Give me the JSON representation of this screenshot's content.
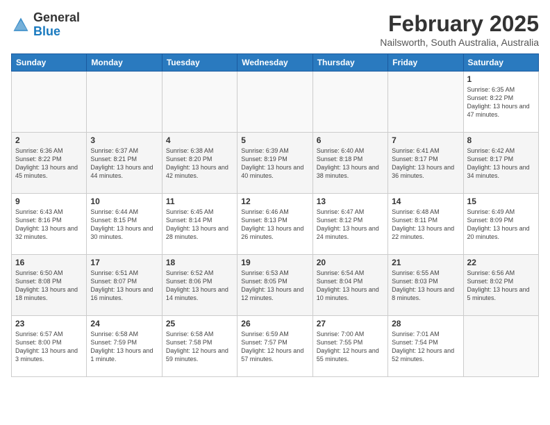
{
  "header": {
    "logo_general": "General",
    "logo_blue": "Blue",
    "month_title": "February 2025",
    "location": "Nailsworth, South Australia, Australia"
  },
  "days_of_week": [
    "Sunday",
    "Monday",
    "Tuesday",
    "Wednesday",
    "Thursday",
    "Friday",
    "Saturday"
  ],
  "weeks": [
    [
      {
        "day": "",
        "info": ""
      },
      {
        "day": "",
        "info": ""
      },
      {
        "day": "",
        "info": ""
      },
      {
        "day": "",
        "info": ""
      },
      {
        "day": "",
        "info": ""
      },
      {
        "day": "",
        "info": ""
      },
      {
        "day": "1",
        "info": "Sunrise: 6:35 AM\nSunset: 8:22 PM\nDaylight: 13 hours and 47 minutes."
      }
    ],
    [
      {
        "day": "2",
        "info": "Sunrise: 6:36 AM\nSunset: 8:22 PM\nDaylight: 13 hours and 45 minutes."
      },
      {
        "day": "3",
        "info": "Sunrise: 6:37 AM\nSunset: 8:21 PM\nDaylight: 13 hours and 44 minutes."
      },
      {
        "day": "4",
        "info": "Sunrise: 6:38 AM\nSunset: 8:20 PM\nDaylight: 13 hours and 42 minutes."
      },
      {
        "day": "5",
        "info": "Sunrise: 6:39 AM\nSunset: 8:19 PM\nDaylight: 13 hours and 40 minutes."
      },
      {
        "day": "6",
        "info": "Sunrise: 6:40 AM\nSunset: 8:18 PM\nDaylight: 13 hours and 38 minutes."
      },
      {
        "day": "7",
        "info": "Sunrise: 6:41 AM\nSunset: 8:17 PM\nDaylight: 13 hours and 36 minutes."
      },
      {
        "day": "8",
        "info": "Sunrise: 6:42 AM\nSunset: 8:17 PM\nDaylight: 13 hours and 34 minutes."
      }
    ],
    [
      {
        "day": "9",
        "info": "Sunrise: 6:43 AM\nSunset: 8:16 PM\nDaylight: 13 hours and 32 minutes."
      },
      {
        "day": "10",
        "info": "Sunrise: 6:44 AM\nSunset: 8:15 PM\nDaylight: 13 hours and 30 minutes."
      },
      {
        "day": "11",
        "info": "Sunrise: 6:45 AM\nSunset: 8:14 PM\nDaylight: 13 hours and 28 minutes."
      },
      {
        "day": "12",
        "info": "Sunrise: 6:46 AM\nSunset: 8:13 PM\nDaylight: 13 hours and 26 minutes."
      },
      {
        "day": "13",
        "info": "Sunrise: 6:47 AM\nSunset: 8:12 PM\nDaylight: 13 hours and 24 minutes."
      },
      {
        "day": "14",
        "info": "Sunrise: 6:48 AM\nSunset: 8:11 PM\nDaylight: 13 hours and 22 minutes."
      },
      {
        "day": "15",
        "info": "Sunrise: 6:49 AM\nSunset: 8:09 PM\nDaylight: 13 hours and 20 minutes."
      }
    ],
    [
      {
        "day": "16",
        "info": "Sunrise: 6:50 AM\nSunset: 8:08 PM\nDaylight: 13 hours and 18 minutes."
      },
      {
        "day": "17",
        "info": "Sunrise: 6:51 AM\nSunset: 8:07 PM\nDaylight: 13 hours and 16 minutes."
      },
      {
        "day": "18",
        "info": "Sunrise: 6:52 AM\nSunset: 8:06 PM\nDaylight: 13 hours and 14 minutes."
      },
      {
        "day": "19",
        "info": "Sunrise: 6:53 AM\nSunset: 8:05 PM\nDaylight: 13 hours and 12 minutes."
      },
      {
        "day": "20",
        "info": "Sunrise: 6:54 AM\nSunset: 8:04 PM\nDaylight: 13 hours and 10 minutes."
      },
      {
        "day": "21",
        "info": "Sunrise: 6:55 AM\nSunset: 8:03 PM\nDaylight: 13 hours and 8 minutes."
      },
      {
        "day": "22",
        "info": "Sunrise: 6:56 AM\nSunset: 8:02 PM\nDaylight: 13 hours and 5 minutes."
      }
    ],
    [
      {
        "day": "23",
        "info": "Sunrise: 6:57 AM\nSunset: 8:00 PM\nDaylight: 13 hours and 3 minutes."
      },
      {
        "day": "24",
        "info": "Sunrise: 6:58 AM\nSunset: 7:59 PM\nDaylight: 13 hours and 1 minute."
      },
      {
        "day": "25",
        "info": "Sunrise: 6:58 AM\nSunset: 7:58 PM\nDaylight: 12 hours and 59 minutes."
      },
      {
        "day": "26",
        "info": "Sunrise: 6:59 AM\nSunset: 7:57 PM\nDaylight: 12 hours and 57 minutes."
      },
      {
        "day": "27",
        "info": "Sunrise: 7:00 AM\nSunset: 7:55 PM\nDaylight: 12 hours and 55 minutes."
      },
      {
        "day": "28",
        "info": "Sunrise: 7:01 AM\nSunset: 7:54 PM\nDaylight: 12 hours and 52 minutes."
      },
      {
        "day": "",
        "info": ""
      }
    ]
  ]
}
